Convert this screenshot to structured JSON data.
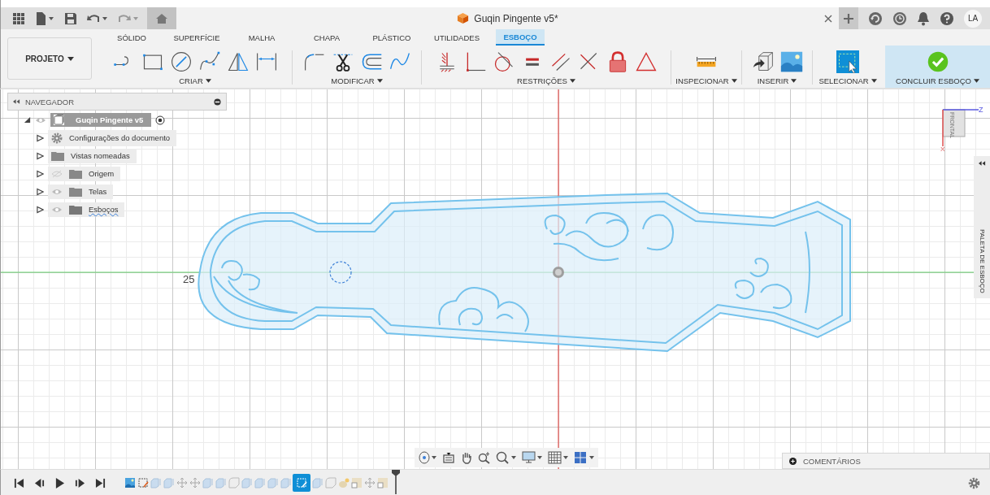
{
  "window": {
    "title": "Guqin Pingente v5*",
    "user_initials": "LA"
  },
  "workspace_button": "PROJETO",
  "ribbon_tabs": [
    {
      "label": "SÓLIDO",
      "selected": false
    },
    {
      "label": "SUPERFÍCIE",
      "selected": false
    },
    {
      "label": "MALHA",
      "selected": false
    },
    {
      "label": "CHAPA",
      "selected": false
    },
    {
      "label": "PLÁSTICO",
      "selected": false
    },
    {
      "label": "UTILIDADES",
      "selected": false
    },
    {
      "label": "ESBOÇO",
      "selected": true
    }
  ],
  "ribbon_groups": [
    "CRIAR",
    "MODIFICAR",
    "RESTRIÇÕES",
    "INSPECIONAR",
    "INSERIR",
    "SELECIONAR",
    "CONCLUIR ESBOÇO"
  ],
  "navigator": {
    "title": "NAVEGADOR",
    "root": {
      "label": "Guqin Pingente v5",
      "expanded": true,
      "children": [
        {
          "label": "Configurações do documento",
          "kind": "settings",
          "expanded": false
        },
        {
          "label": "Vistas nomeadas",
          "kind": "folder",
          "expanded": false
        },
        {
          "label": "Origem",
          "kind": "folder",
          "visible": false,
          "expanded": false
        },
        {
          "label": "Telas",
          "kind": "folder",
          "visible": true,
          "expanded": false
        },
        {
          "label": "Esboços",
          "kind": "sketches",
          "visible": true,
          "expanded": false
        }
      ]
    }
  },
  "canvas": {
    "dimension": "25",
    "view_cube": "FRONTAL",
    "axis_z": "Z",
    "axis_x": "X",
    "sketch_palette": "PALETA DE ESBOÇO",
    "comments": "COMENTÁRIOS"
  },
  "timeline": {
    "features": [
      {
        "kind": "image",
        "selected": false
      },
      {
        "kind": "sketch",
        "selected": false
      },
      {
        "kind": "extrude",
        "selected": false
      },
      {
        "kind": "extrude",
        "selected": false
      },
      {
        "kind": "move",
        "selected": false
      },
      {
        "kind": "move",
        "selected": false
      },
      {
        "kind": "extrude",
        "selected": false
      },
      {
        "kind": "extrude",
        "selected": false
      },
      {
        "kind": "fillet",
        "selected": false
      },
      {
        "kind": "extrude",
        "selected": false
      },
      {
        "kind": "extrude",
        "selected": false
      },
      {
        "kind": "extrude",
        "selected": false
      },
      {
        "kind": "extrude",
        "selected": false
      },
      {
        "kind": "sketch",
        "selected": true
      },
      {
        "kind": "extrude",
        "selected": false
      },
      {
        "kind": "fillet",
        "selected": false
      },
      {
        "kind": "texture",
        "selected": false
      },
      {
        "kind": "frame",
        "selected": false
      },
      {
        "kind": "move",
        "selected": false
      },
      {
        "kind": "frame",
        "selected": false
      }
    ]
  }
}
